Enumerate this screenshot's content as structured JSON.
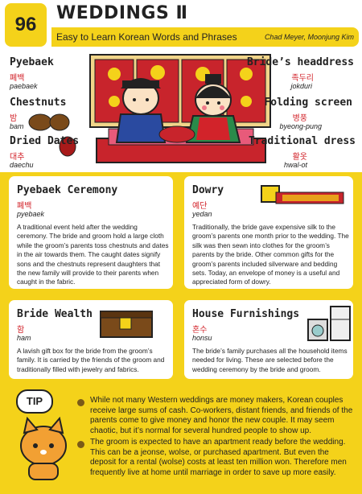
{
  "header": {
    "number": "96",
    "title": "WEDDINGS Ⅱ",
    "subtitle": "Easy to Learn Korean Words and Phrases",
    "authors": "Chad Meyer,  Moonjung Kim"
  },
  "labels": {
    "pyebaek": {
      "en": "Pyebaek",
      "ko": "폐백",
      "ro": "paebaek"
    },
    "chestnuts": {
      "en": "Chestnuts",
      "ko": "밤",
      "ro": "bam"
    },
    "dates": {
      "en": "Dried Dates",
      "ko": "대추",
      "ro": "daechu"
    },
    "headdress": {
      "en": "Bride’s headdress",
      "ko": "족두리",
      "ro": "jokduri"
    },
    "screen": {
      "en": "Folding screen",
      "ko": "병풍",
      "ro": "byeong-pung"
    },
    "dress": {
      "en": "Traditional dress",
      "ko": "활옷",
      "ro": "hwal-ot"
    }
  },
  "cards": {
    "ceremony": {
      "title": "Pyebaek Ceremony",
      "ko": "폐백",
      "ro": "pyebaek",
      "body": "A traditional event held after the wedding ceremony.  The bride and groom hold a large cloth while the groom’s parents toss chestnuts and dates in the air towards them.  The caught dates signify sons and the chestnuts represent daughters that the new family will provide to their parents when caught in the fabric."
    },
    "dowry": {
      "title": "Dowry",
      "ko": "예단",
      "ro": "yedan",
      "body": "Traditionally, the bride gave expensive silk to the groom’s parents one month prior to the wedding.  The silk was then sewn into clothes for the groom’s parents by the bride.  Other common gifts for the groom’s parents included silverware and bedding sets.  Today, an envelope of money is a useful and appreciated form of dowry."
    },
    "wealth": {
      "title": "Bride Wealth",
      "ko": "함",
      "ro": "ham",
      "body": "A lavish gift box for the bride from the groom’s family.  It is carried by the friends of the groom and traditionally filled with jewelry and fabrics."
    },
    "furnish": {
      "title": "House Furnishings",
      "ko": "혼수",
      "ro": "honsu",
      "body": "The bride’s family purchases all the household items needed for living.  These are selected before the wedding ceremony by the bride and groom."
    }
  },
  "tip": {
    "badge": "TIP",
    "p1": "While not many Western weddings are money makers, Korean couples receive large sums of cash.  Co-workers, distant friends, and friends of the parents come to give money and honor the new couple.  It may seem chaotic, but it’s normal for several hundred people to show up.",
    "p2": "The groom is expected to have an apartment ready before the wedding.  This can be a jeonse, wolse, or purchased apartment.  But even the deposit for a rental (wolse) costs at least ten million won.  Therefore men frequently live at home until marriage in order to save up more easily."
  },
  "colors": {
    "accent": "#f4d21a",
    "korean": "#d2232a",
    "text": "#222222"
  }
}
